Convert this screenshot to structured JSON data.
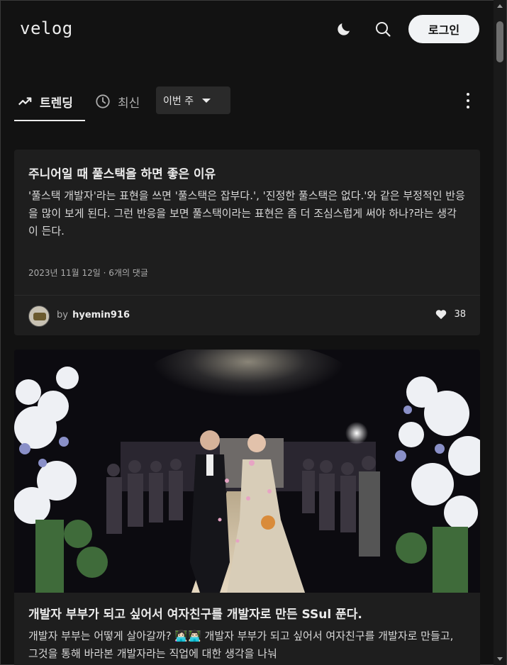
{
  "header": {
    "logo": "velog",
    "login_label": "로그인"
  },
  "tabs": {
    "trending_label": "트렌딩",
    "recent_label": "최신",
    "period_label": "이번 주"
  },
  "posts": [
    {
      "title": "주니어일 때 풀스택을 하면 좋은 이유",
      "description": "'풀스택 개발자'라는 표현을 쓰면 '풀스택은 잡부다.', '진정한 풀스택은 없다.'와 같은 부정적인 반응을 많이 보게 된다. 그런 반응을 보면 풀스택이라는 표현은 좀 더 조심스럽게 써야 하나?라는 생각이 든다.",
      "meta": "2023년 11월 12일 · 6개의 댓글",
      "by": "by",
      "author": "hyemin916",
      "likes": "38"
    },
    {
      "title": "개발자 부부가 되고 싶어서 여자친구를 개발자로 만든 SSul 푼다.",
      "description": "개발자 부부는 어떻게 살아갈까? 👩🏻‍💻👨🏻‍💻 개발자 부부가 되고 싶어서 여자친구를 개발자로 만들고, 그것을 통해 바라본 개발자라는 직업에 대한 생각을 나눠"
    }
  ],
  "colors": {
    "background": "#121212",
    "card": "#1e1e1e",
    "text": "#ececec",
    "muted": "#acacac"
  },
  "icons": [
    "moon-icon",
    "search-icon",
    "trending-icon",
    "clock-icon",
    "heart-icon",
    "kebab-menu-icon"
  ]
}
